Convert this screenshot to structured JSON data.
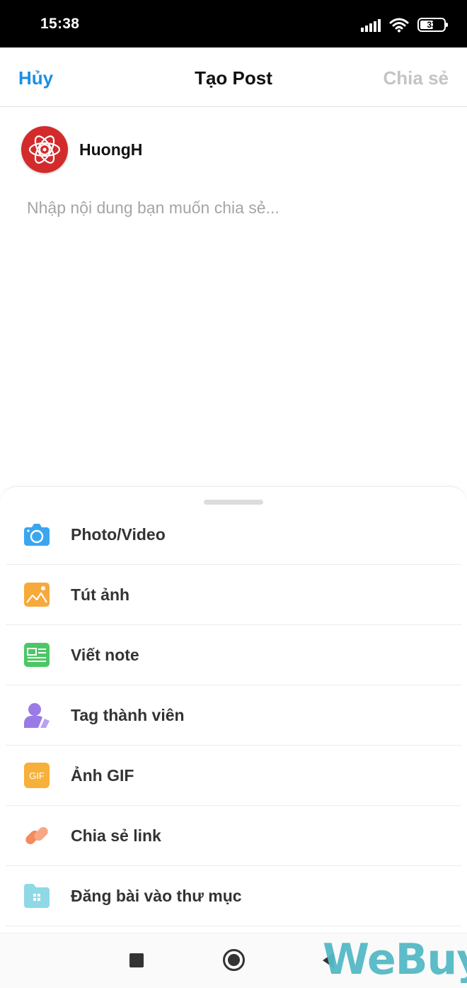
{
  "status_bar": {
    "time": "15:38",
    "battery_level": "33",
    "icons": [
      "signal-icon",
      "wifi-icon",
      "battery-icon"
    ]
  },
  "header": {
    "cancel_label": "Hủy",
    "title": "Tạo Post",
    "share_label": "Chia sẻ"
  },
  "author": {
    "name": "HuongH",
    "avatar_color": "#d32b2b"
  },
  "composer": {
    "placeholder": "Nhập nội dung bạn muốn chia sẻ...",
    "value": ""
  },
  "menu": {
    "items": [
      {
        "label": "Photo/Video",
        "icon": "camera-icon",
        "color": "#3aa6f0"
      },
      {
        "label": "Tút ảnh",
        "icon": "image-icon",
        "color": "#f7a93a"
      },
      {
        "label": "Viết note",
        "icon": "note-icon",
        "color": "#4cc765"
      },
      {
        "label": "Tag thành viên",
        "icon": "tag-user-icon",
        "color": "#9a7be6"
      },
      {
        "label": "Ảnh GIF",
        "icon": "gif-icon",
        "color": "#f7b03a",
        "icon_text": "GIF"
      },
      {
        "label": "Chia sẻ link",
        "icon": "link-icon",
        "color": "#f58a5c"
      },
      {
        "label": "Đăng bài vào thư mục",
        "icon": "folder-icon",
        "color": "#8fd9e6"
      }
    ]
  },
  "nav_bar": {
    "buttons": [
      "recents-button",
      "home-button",
      "back-button"
    ]
  },
  "watermark": {
    "text_main": "WeBuy"
  },
  "colors": {
    "accent_blue": "#1a8fe3",
    "disabled_gray": "#c4c4c4"
  }
}
